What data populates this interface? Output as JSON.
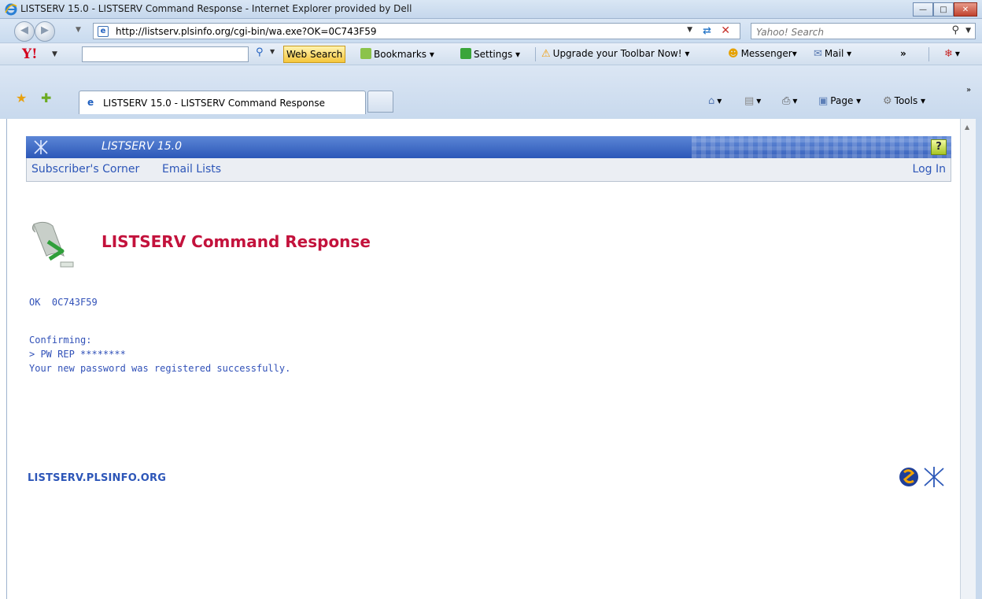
{
  "window": {
    "title": "LISTSERV 15.0 - LISTSERV Command Response - Internet Explorer provided by Dell"
  },
  "address_bar": {
    "url": "http://listserv.plsinfo.org/cgi-bin/wa.exe?OK=0C743F59",
    "search_placeholder": "Yahoo! Search"
  },
  "yahoo_toolbar": {
    "web_search": "Web Search",
    "bookmarks": "Bookmarks",
    "settings": "Settings",
    "upgrade": "Upgrade your Toolbar Now!",
    "messenger": "Messenger",
    "mail": "Mail",
    "more": "»"
  },
  "tabs": [
    {
      "label": "LISTSERV 15.0 - LISTSERV Command Response"
    }
  ],
  "command_bar": {
    "page": "Page",
    "tools": "Tools"
  },
  "listserv": {
    "banner_title": "LISTSERV 15.0",
    "help": "?",
    "menu": {
      "subscribers_corner": "Subscriber's Corner",
      "email_lists": "Email Lists",
      "log_in": "Log In"
    },
    "page_title": "LISTSERV Command Response",
    "response": {
      "ok_line": "OK  0C743F59",
      "confirming": "Confirming:",
      "command": "> PW REP ********",
      "result": "Your new password was registered successfully."
    },
    "footer_host": "LISTSERV.PLSINFO.ORG"
  },
  "colors": {
    "banner_blue": "#2c58b8",
    "title_red": "#c3123c",
    "text_blue": "#3151b8"
  }
}
